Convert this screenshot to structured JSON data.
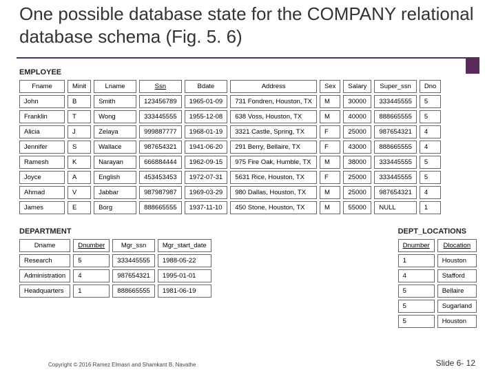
{
  "title": "One possible database state for the COMPANY relational database schema (Fig. 5. 6)",
  "employee": {
    "label": "EMPLOYEE",
    "headers": [
      "Fname",
      "Minit",
      "Lname",
      "Ssn",
      "Bdate",
      "Address",
      "Sex",
      "Salary",
      "Super_ssn",
      "Dno"
    ],
    "underline": [
      false,
      false,
      false,
      true,
      false,
      false,
      false,
      false,
      false,
      false
    ],
    "rows": [
      [
        "John",
        "B",
        "Smith",
        "123456789",
        "1965-01-09",
        "731 Fondren, Houston, TX",
        "M",
        "30000",
        "333445555",
        "5"
      ],
      [
        "Franklin",
        "T",
        "Wong",
        "333445555",
        "1955-12-08",
        "638 Voss, Houston, TX",
        "M",
        "40000",
        "888665555",
        "5"
      ],
      [
        "Alicia",
        "J",
        "Zelaya",
        "999887777",
        "1968-01-19",
        "3321 Castle, Spring, TX",
        "F",
        "25000",
        "987654321",
        "4"
      ],
      [
        "Jennifer",
        "S",
        "Wallace",
        "987654321",
        "1941-06-20",
        "291 Berry, Bellaire, TX",
        "F",
        "43000",
        "888665555",
        "4"
      ],
      [
        "Ramesh",
        "K",
        "Narayan",
        "666884444",
        "1962-09-15",
        "975 Fire Oak, Humble, TX",
        "M",
        "38000",
        "333445555",
        "5"
      ],
      [
        "Joyce",
        "A",
        "English",
        "453453453",
        "1972-07-31",
        "5631 Rice, Houston, TX",
        "F",
        "25000",
        "333445555",
        "5"
      ],
      [
        "Ahmad",
        "V",
        "Jabbar",
        "987987987",
        "1969-03-29",
        "980 Dallas, Houston, TX",
        "M",
        "25000",
        "987654321",
        "4"
      ],
      [
        "James",
        "E",
        "Borg",
        "888665555",
        "1937-11-10",
        "450 Stone, Houston, TX",
        "M",
        "55000",
        "NULL",
        "1"
      ]
    ]
  },
  "department": {
    "label": "DEPARTMENT",
    "headers": [
      "Dname",
      "Dnumber",
      "Mgr_ssn",
      "Mgr_start_date"
    ],
    "underline": [
      false,
      true,
      false,
      false
    ],
    "rows": [
      [
        "Research",
        "5",
        "333445555",
        "1988-05-22"
      ],
      [
        "Administration",
        "4",
        "987654321",
        "1995-01-01"
      ],
      [
        "Headquarters",
        "1",
        "888665555",
        "1981-06-19"
      ]
    ]
  },
  "dept_locations": {
    "label": "DEPT_LOCATIONS",
    "headers": [
      "Dnumber",
      "Dlocation"
    ],
    "underline": [
      true,
      true
    ],
    "rows": [
      [
        "1",
        "Houston"
      ],
      [
        "4",
        "Stafford"
      ],
      [
        "5",
        "Bellaire"
      ],
      [
        "5",
        "Sugarland"
      ],
      [
        "5",
        "Houston"
      ]
    ]
  },
  "footer": {
    "copyright": "Copyright © 2016 Ramez Elmasri and Shamkant B. Navathe",
    "slide": "Slide 6- 12"
  }
}
